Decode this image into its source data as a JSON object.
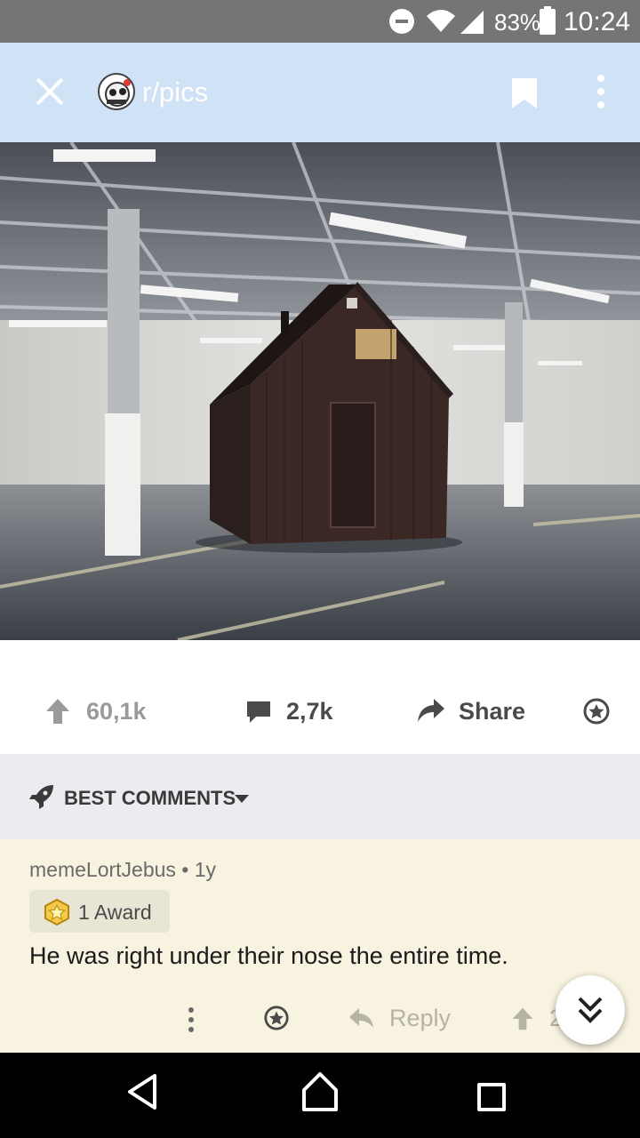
{
  "status_bar": {
    "battery_percent": "83%",
    "time": "10:24"
  },
  "header": {
    "subreddit": "r/pics",
    "icons": [
      "close-icon",
      "subreddit-avatar",
      "bookmark-icon",
      "more-vert-icon"
    ]
  },
  "post": {
    "image_icon": "post-image",
    "upvotes": "60,1k",
    "comments": "2,7k",
    "share_label": "Share"
  },
  "sort": {
    "label": "BEST COMMENTS"
  },
  "comment": {
    "author": "memeLortJebus",
    "age": "1y",
    "meta": "memeLortJebus • 1y",
    "award_label": "1 Award",
    "body": "He was right under their nose the entire time.",
    "reply_label": "Reply",
    "score": "2"
  },
  "colors": {
    "status_bar": "#757575",
    "app_bar": "#cfe2f6",
    "sort_bar": "#ebecef",
    "comment_bg": "#f8f3e0",
    "nav_bar": "#000000"
  }
}
